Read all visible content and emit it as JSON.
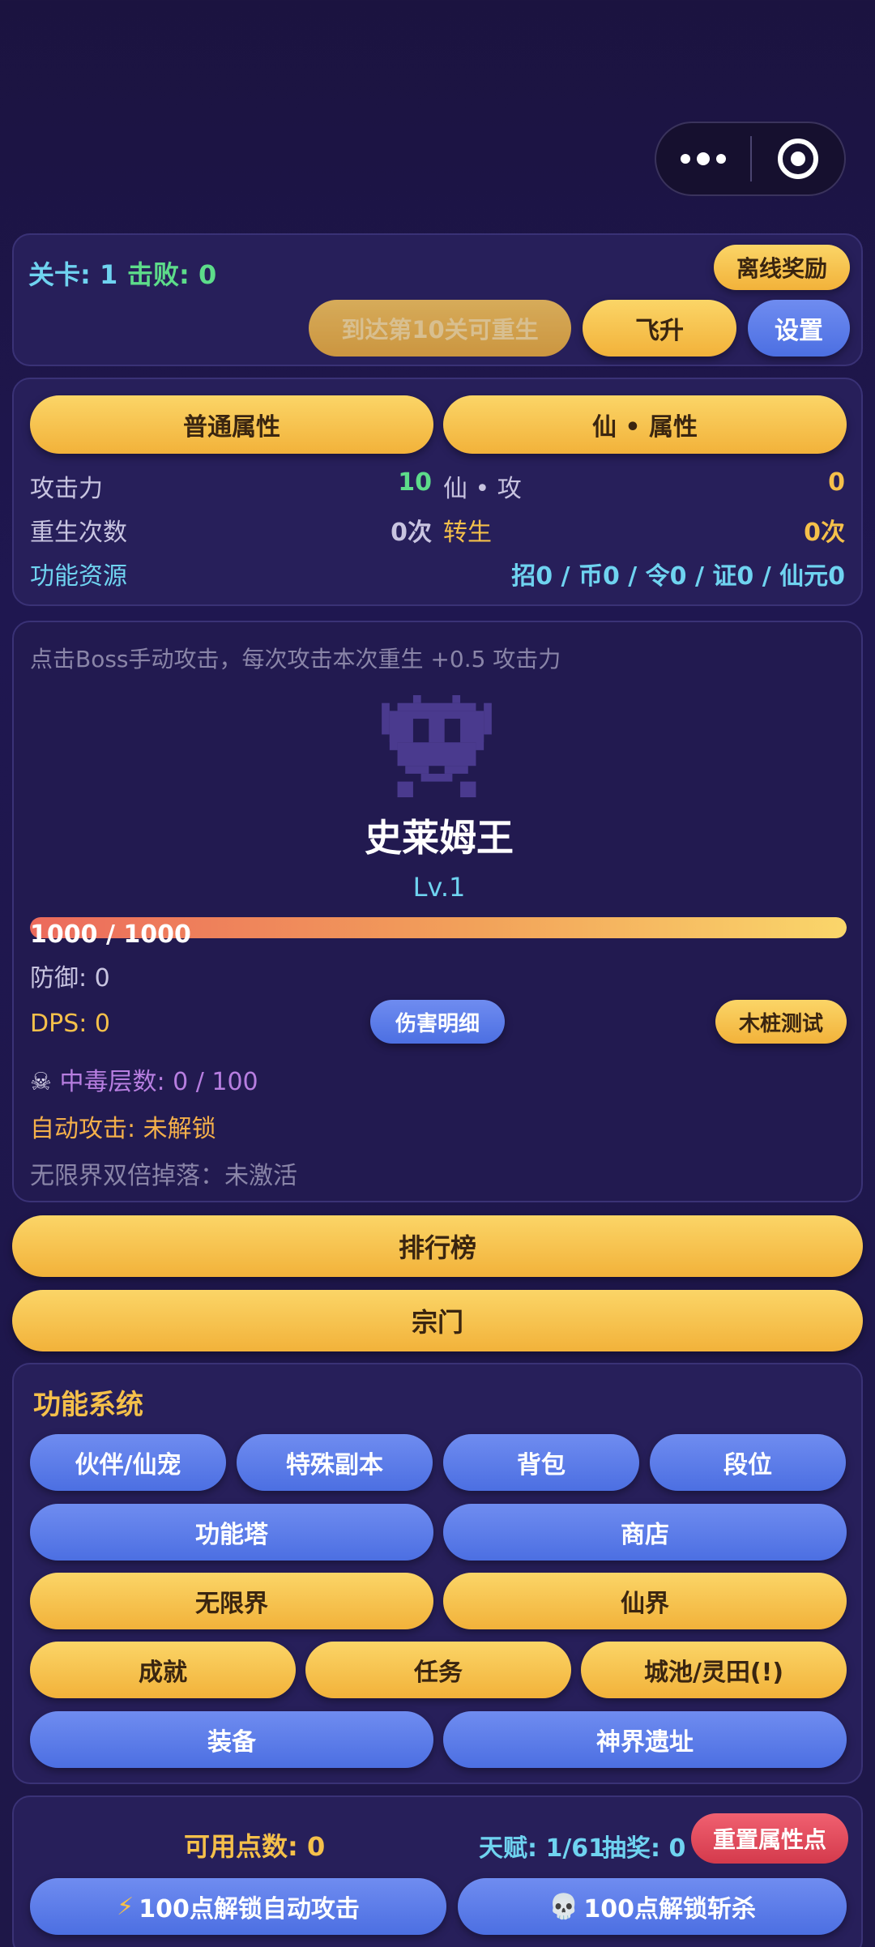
{
  "header": {
    "more_icon": "more-dots-icon",
    "close_icon": "target-circle-icon"
  },
  "top": {
    "level_label": "关卡: 1",
    "defeat_label": "击败: 0",
    "offline_reward": "离线奖励",
    "rebirth_hint": "到达第10关可重生",
    "ascend": "飞升",
    "settings": "设置"
  },
  "attributes": {
    "tab_normal": "普通属性",
    "tab_immortal": "仙 • 属性",
    "rows": [
      {
        "left_label": "攻击力",
        "left_value": "10",
        "right_label": "仙 • 攻",
        "right_value": "0"
      },
      {
        "left_label": "重生次数",
        "left_value": "0次",
        "right_label": "转生",
        "right_value": "0次"
      }
    ],
    "resource_label": "功能资源",
    "resource_value": "招0 / 币0 / 令0 / 证0 / 仙元0"
  },
  "boss": {
    "hint": "点击Boss手动攻击，每次攻击本次重生 +0.5 攻击力",
    "name": "史莱姆王",
    "level": "Lv.1",
    "hp_text": "1000 / 1000",
    "hp_fraction": 1.0,
    "defense": "防御: 0",
    "dps": "DPS: 0",
    "damage_detail": "伤害明细",
    "stake_test": "木桩测试",
    "poison_icon": "skull-crossbones-icon",
    "poison": "中毒层数: 0 / 100",
    "auto_attack": "自动攻击: 未解锁",
    "double_drop": "无限界双倍掉落：未激活"
  },
  "main_buttons": {
    "ranking": "排行榜",
    "sect": "宗门"
  },
  "functions": {
    "title": "功能系统",
    "row1": [
      "伙伴/仙宠",
      "特殊副本",
      "背包",
      "段位"
    ],
    "row2": [
      "功能塔",
      "商店"
    ],
    "row3": [
      "无限界",
      "仙界"
    ],
    "row4": [
      "成就",
      "任务",
      "城池/灵田(!)"
    ],
    "row5": [
      "装备",
      "神界遗址"
    ]
  },
  "points": {
    "available": "可用点数: 0",
    "talent": "天赋: 1/61",
    "lottery": "抽奖: 0",
    "reset": "重置属性点",
    "unlock_auto_icon": "lightning-icon",
    "unlock_auto": "100点解锁自动攻击",
    "unlock_kill_icon": "skull-icon",
    "unlock_kill": "100点解锁斩杀"
  },
  "colors": {
    "gold": "#f5c04a",
    "blue": "#5a7ce8",
    "cyan": "#6fd3f0",
    "green": "#5ddc8a",
    "purple": "#b77ee0",
    "orange": "#f5b04a",
    "red": "#e24a5c"
  }
}
